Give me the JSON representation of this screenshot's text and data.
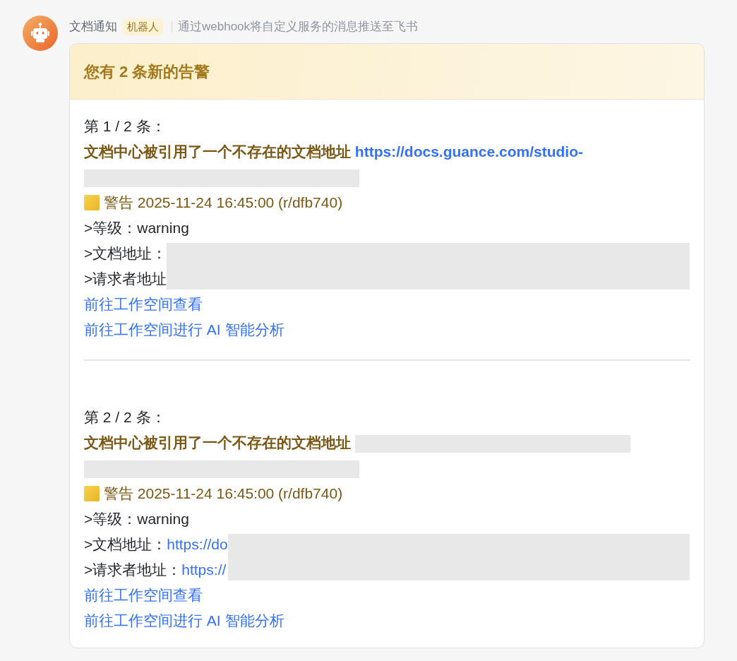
{
  "sender": {
    "name": "文档通知",
    "badge": "机器人",
    "description": "通过webhook将自定义服务的消息推送至飞书"
  },
  "card": {
    "title": "您有 2 条新的告警",
    "messages": [
      {
        "index_label": "第 1 / 2 条：",
        "title": [
          {
            "kind": "text",
            "text": "文档中心被引用了一个不存在的文档地址"
          },
          {
            "kind": "link",
            "text": "https://docs.guance.com/studio-"
          },
          {
            "kind": "redacted"
          }
        ],
        "severity": "警告 2025-11-24 16:45:00 (r/dfb740)",
        "grade": ">等级：warning",
        "addresses": {
          "redacted": true,
          "rows": [
            {
              "label": ">文档地址："
            },
            {
              "label": ">请求者地址"
            }
          ]
        },
        "links": [
          "前往工作空间查看",
          "前往工作空间进行 AI 智能分析"
        ]
      },
      {
        "index_label": "第 2 / 2 条：",
        "title": [
          {
            "kind": "text",
            "text": "文档中心被引用了一个不存在的文档地址"
          },
          {
            "kind": "redacted"
          },
          {
            "kind": "redacted"
          }
        ],
        "severity": "警告 2025-11-24 16:45:00 (r/dfb740)",
        "grade": ">等级：warning",
        "addresses": {
          "redacted": true,
          "rows": [
            {
              "label": ">文档地址：",
              "value": "https://do"
            },
            {
              "label": ">请求者地址：",
              "value": "https://"
            }
          ]
        },
        "links": [
          "前往工作空间查看",
          "前往工作空间进行 AI 智能分析"
        ]
      }
    ]
  }
}
